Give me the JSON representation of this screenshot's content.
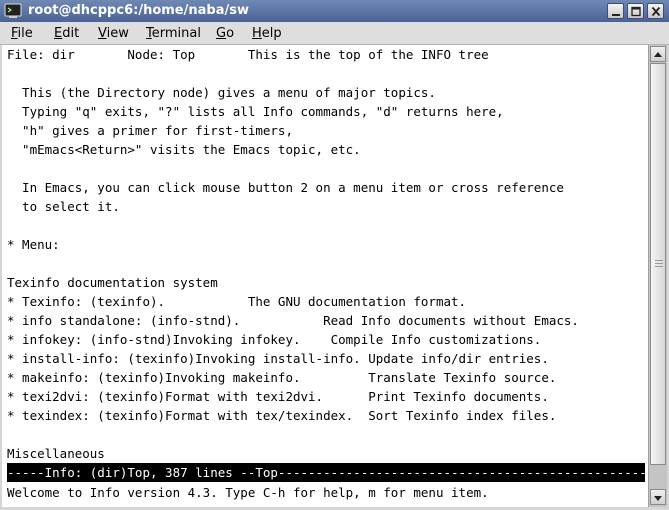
{
  "window": {
    "title": "root@dhcppc6:/home/naba/sw"
  },
  "menubar": {
    "items": [
      {
        "label": "File",
        "mnemonic": "F",
        "rest": "ile"
      },
      {
        "label": "Edit",
        "mnemonic": "E",
        "rest": "dit"
      },
      {
        "label": "View",
        "mnemonic": "V",
        "rest": "iew"
      },
      {
        "label": "Terminal",
        "mnemonic": "T",
        "rest": "erminal"
      },
      {
        "label": "Go",
        "mnemonic": "G",
        "rest": "o"
      },
      {
        "label": "Help",
        "mnemonic": "H",
        "rest": "elp"
      }
    ]
  },
  "terminal": {
    "lines": [
      "File: dir       Node: Top       This is the top of the INFO tree",
      "",
      "  This (the Directory node) gives a menu of major topics.",
      "  Typing \"q\" exits, \"?\" lists all Info commands, \"d\" returns here,",
      "  \"h\" gives a primer for first-timers,",
      "  \"mEmacs<Return>\" visits the Emacs topic, etc.",
      "",
      "  In Emacs, you can click mouse button 2 on a menu item or cross reference",
      "  to select it.",
      "",
      "* Menu:",
      "",
      "Texinfo documentation system",
      "* Texinfo: (texinfo).           The GNU documentation format.",
      "* info standalone: (info-stnd).           Read Info documents without Emacs.",
      "* infokey: (info-stnd)Invoking infokey.    Compile Info customizations.",
      "* install-info: (texinfo)Invoking install-info. Update info/dir entries.",
      "* makeinfo: (texinfo)Invoking makeinfo.         Translate Texinfo source.",
      "* texi2dvi: (texinfo)Format with texi2dvi.      Print Texinfo documents.",
      "* texindex: (texinfo)Format with tex/texindex.  Sort Texinfo index files.",
      "",
      "Miscellaneous"
    ],
    "modeline": "-----Info: (dir)Top, 387 lines --Top---------------------------------------------------------",
    "echo": "Welcome to Info version 4.3. Type C-h for help, m for menu item."
  }
}
